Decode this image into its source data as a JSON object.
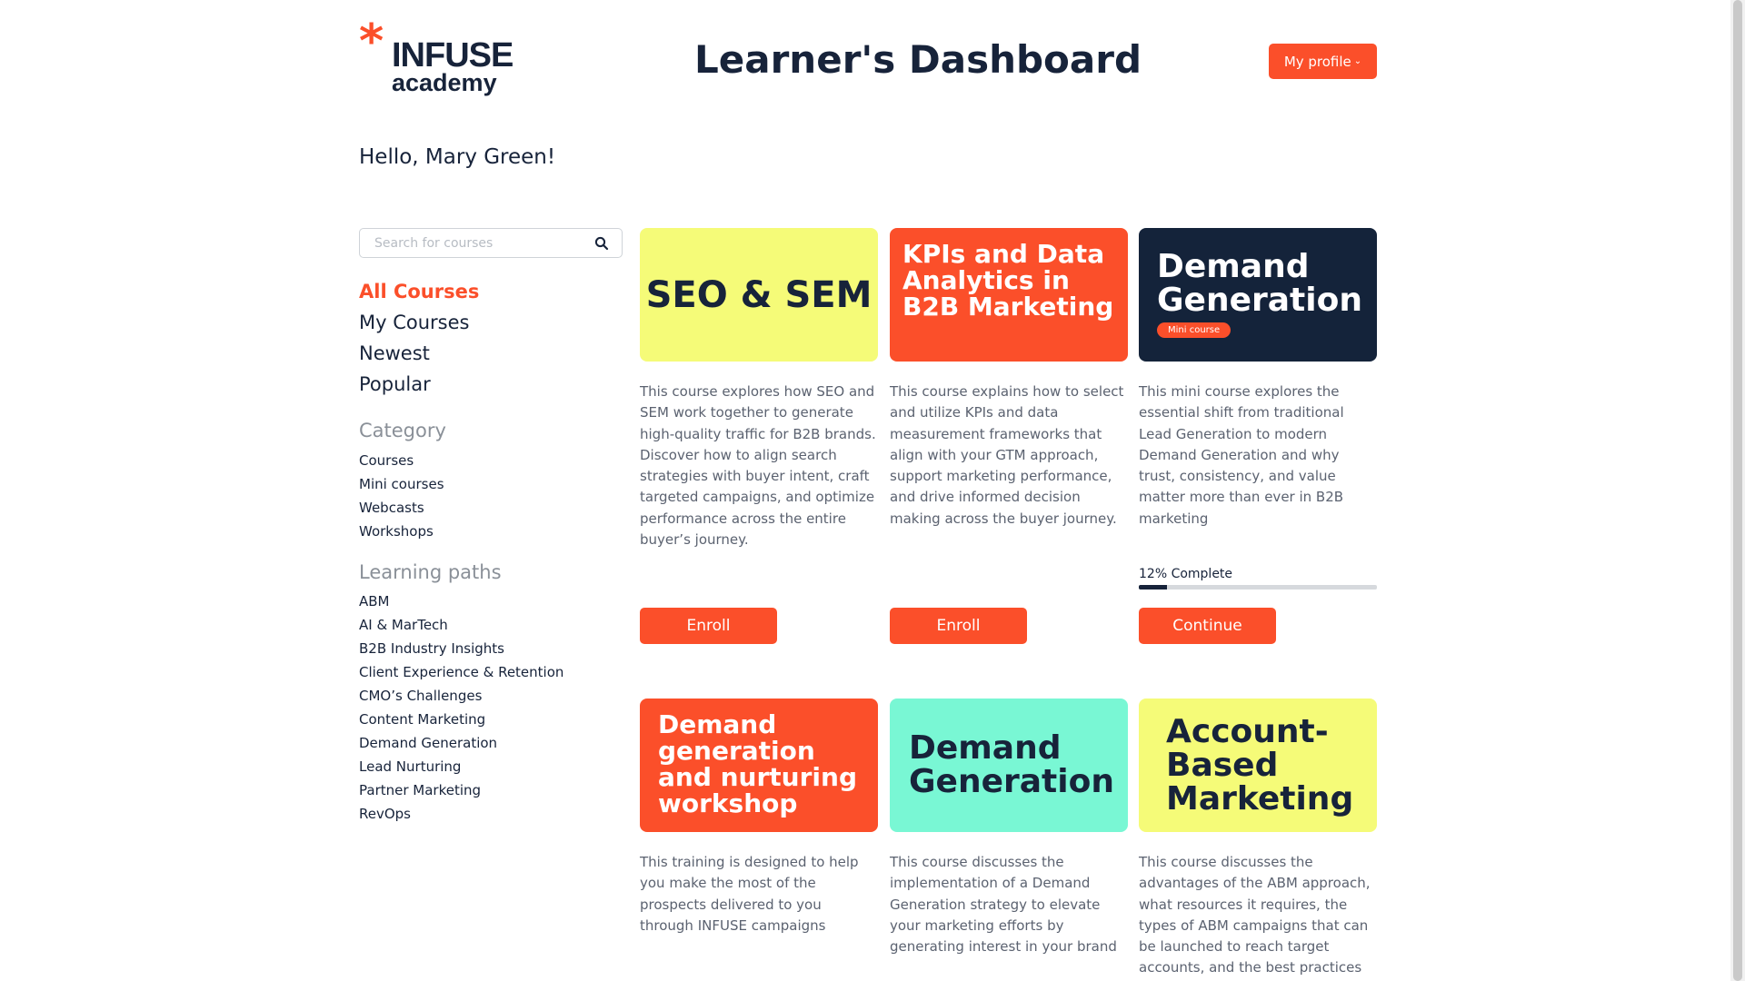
{
  "header": {
    "logo_mark": "*",
    "logo_brand": "INFUSE",
    "logo_sub": "academy",
    "title": "Learner's Dashboard",
    "profile_label": "My profile",
    "profile_chevron": "⌄"
  },
  "greeting": "Hello, Mary Green!",
  "search": {
    "placeholder": "Search for courses",
    "value": ""
  },
  "nav": {
    "items": [
      {
        "label": "All Courses",
        "active": true
      },
      {
        "label": "My Courses",
        "active": false
      },
      {
        "label": "Newest",
        "active": false
      },
      {
        "label": "Popular",
        "active": false
      }
    ]
  },
  "category": {
    "heading": "Category",
    "items": [
      "Courses",
      "Mini courses",
      "Webcasts",
      "Workshops"
    ]
  },
  "learning_paths": {
    "heading": "Learning paths",
    "items": [
      "ABM",
      "AI & MarTech",
      "B2B Industry Insights",
      "Client Experience & Retention",
      "CMO’s Challenges",
      "Content Marketing",
      "Demand Generation",
      "Lead Nurturing",
      "Partner Marketing",
      "RevOps"
    ]
  },
  "courses": [
    {
      "banner_title": "SEO & SEM",
      "banner_bg": "#f5fb78",
      "banner_fg": "#17233a",
      "description": "This course explores how SEO and SEM work together to generate high-quality traffic for B2B brands. Discover how to align search strategies with buyer intent, craft targeted campaigns, and optimize performance across the entire buyer’s journey.",
      "action": "Enroll"
    },
    {
      "banner_title": "KPIs and Data Analytics in B2B Marketing",
      "banner_bg": "#fb4f2a",
      "banner_fg": "#ffffff",
      "description": "This course explains how to select and utilize KPIs and data measurement frameworks that align with your GTM approach, support marketing performance, and drive informed decision making across the buyer journey.",
      "action": "Enroll"
    },
    {
      "banner_title": "Demand Generation",
      "banner_badge": "Mini course",
      "banner_bg": "#14233a",
      "banner_fg": "#ffffff",
      "description": "This mini course explores the essential shift from traditional Lead Generation to modern Demand Generation and why trust, consistency, and value matter more than ever in B2B marketing",
      "progress_label": "12% Complete",
      "progress": 0.12,
      "action": "Continue"
    },
    {
      "banner_title": "Demand generation and nurturing workshop",
      "banner_bg": "#fb4f2a",
      "banner_fg": "#ffffff",
      "description": "This training is designed to help you make the most of the prospects delivered to you through INFUSE campaigns"
    },
    {
      "banner_title": "Demand Generation",
      "banner_bg": "#79f7d4",
      "banner_fg": "#17233a",
      "description": "This course discusses the implementation of a Demand Generation strategy to elevate your marketing efforts by generating interest in your brand"
    },
    {
      "banner_title": "Account-Based Marketing",
      "banner_bg": "#f5fb78",
      "banner_fg": "#17233a",
      "description": "This course discusses the advantages of the ABM approach, what resources it requires, the types of ABM campaigns that can be launched to reach target accounts, and the best practices"
    }
  ]
}
